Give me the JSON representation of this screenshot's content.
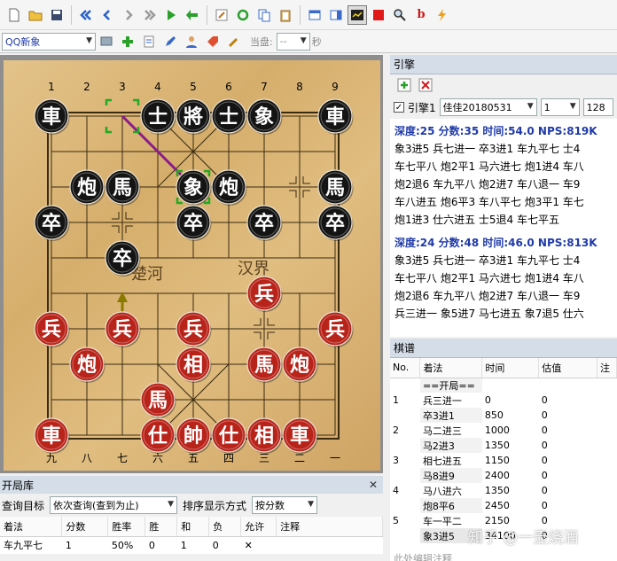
{
  "toolbar": {
    "icons": [
      "new-file-icon",
      "open-folder-icon",
      "save-icon",
      "first-move-icon",
      "prev-move-icon",
      "next-move-icon",
      "last-move-icon",
      "play-icon",
      "back-icon",
      "edit-icon",
      "refresh-icon",
      "copy-icon",
      "paste-icon",
      "window-icon",
      "layout-icon",
      "analysis-icon",
      "red-square-icon",
      "search-icon",
      "b-icon",
      "lightning-icon"
    ],
    "profile": "QQ新象",
    "step_label": "当盘:",
    "step_value": "--",
    "seconds_label": "秒"
  },
  "board": {
    "file_numbers_top": [
      "1",
      "2",
      "3",
      "4",
      "5",
      "6",
      "7",
      "8",
      "9"
    ],
    "file_numbers_bottom": [
      "九",
      "八",
      "七",
      "六",
      "五",
      "四",
      "三",
      "二",
      "一"
    ],
    "river_left": "楚河",
    "river_right": "汉界",
    "pieces": [
      {
        "side": "black",
        "char": "車",
        "file": 0,
        "rank": 0
      },
      {
        "side": "black",
        "char": "士",
        "file": 3,
        "rank": 0
      },
      {
        "side": "black",
        "char": "將",
        "file": 4,
        "rank": 0
      },
      {
        "side": "black",
        "char": "士",
        "file": 5,
        "rank": 0
      },
      {
        "side": "black",
        "char": "象",
        "file": 6,
        "rank": 0
      },
      {
        "side": "black",
        "char": "車",
        "file": 8,
        "rank": 0
      },
      {
        "side": "black",
        "char": "炮",
        "file": 1,
        "rank": 2
      },
      {
        "side": "black",
        "char": "馬",
        "file": 2,
        "rank": 2
      },
      {
        "side": "black",
        "char": "象",
        "file": 4,
        "rank": 2
      },
      {
        "side": "black",
        "char": "炮",
        "file": 5,
        "rank": 2
      },
      {
        "side": "black",
        "char": "馬",
        "file": 8,
        "rank": 2
      },
      {
        "side": "black",
        "char": "卒",
        "file": 0,
        "rank": 3
      },
      {
        "side": "black",
        "char": "卒",
        "file": 4,
        "rank": 3
      },
      {
        "side": "black",
        "char": "卒",
        "file": 6,
        "rank": 3
      },
      {
        "side": "black",
        "char": "卒",
        "file": 8,
        "rank": 3
      },
      {
        "side": "black",
        "char": "卒",
        "file": 2,
        "rank": 4
      },
      {
        "side": "red",
        "char": "兵",
        "file": 6,
        "rank": 5
      },
      {
        "side": "red",
        "char": "兵",
        "file": 0,
        "rank": 6
      },
      {
        "side": "red",
        "char": "兵",
        "file": 2,
        "rank": 6
      },
      {
        "side": "red",
        "char": "兵",
        "file": 4,
        "rank": 6
      },
      {
        "side": "red",
        "char": "兵",
        "file": 8,
        "rank": 6
      },
      {
        "side": "red",
        "char": "炮",
        "file": 1,
        "rank": 7
      },
      {
        "side": "red",
        "char": "相",
        "file": 4,
        "rank": 7
      },
      {
        "side": "red",
        "char": "馬",
        "file": 6,
        "rank": 7
      },
      {
        "side": "red",
        "char": "炮",
        "file": 7,
        "rank": 7
      },
      {
        "side": "red",
        "char": "馬",
        "file": 3,
        "rank": 8
      },
      {
        "side": "red",
        "char": "車",
        "file": 0,
        "rank": 9
      },
      {
        "side": "red",
        "char": "仕",
        "file": 3,
        "rank": 9
      },
      {
        "side": "red",
        "char": "帥",
        "file": 4,
        "rank": 9
      },
      {
        "side": "red",
        "char": "仕",
        "file": 5,
        "rank": 9
      },
      {
        "side": "red",
        "char": "相",
        "file": 6,
        "rank": 9
      },
      {
        "side": "red",
        "char": "車",
        "file": 7,
        "rank": 9
      }
    ]
  },
  "engine": {
    "title": "引擎",
    "checkbox_label": "引擎1",
    "engine_name": "佳佳20180531",
    "thread_value": "1",
    "hash_value": "128",
    "blocks": [
      {
        "header": "深度:25 分数:35 时间:54.0 NPS:819K",
        "lines": [
          "象3进5 兵七进一 卒3进1 车九平七 士4",
          "车七平八 炮2平1 马六进七 炮1进4 车八",
          "炮2退6 车九平八 炮2进7 车八退一 车9",
          "车八进五 炮6平3 车八平七 炮3平1 车七",
          "炮1进3 仕六进五 士5退4 车七平五"
        ]
      },
      {
        "header": "深度:24 分数:48 时间:46.0 NPS:813K",
        "lines": [
          "象3进5 兵七进一 卒3进1 车九平七 士4",
          "车七平八 炮2平1 马六进七 炮1进4 车八",
          "炮2退6 车九平八 炮2进7 车八退一 车9",
          "兵三进一 象5进7 马七进五 象7退5 仕六"
        ]
      }
    ]
  },
  "notation": {
    "title": "棋谱",
    "columns": [
      "No.",
      "着法",
      "时间",
      "估值",
      "注"
    ],
    "rows": [
      {
        "no": "",
        "move": "==开局==",
        "time": "",
        "eval": ""
      },
      {
        "no": "1",
        "move": "兵三进一",
        "time": "0",
        "eval": "0"
      },
      {
        "no": "",
        "move": "卒3进1",
        "time": "850",
        "eval": "0"
      },
      {
        "no": "2",
        "move": "马二进三",
        "time": "1000",
        "eval": "0"
      },
      {
        "no": "",
        "move": "马2进3",
        "time": "1350",
        "eval": "0"
      },
      {
        "no": "3",
        "move": "相七进五",
        "time": "1150",
        "eval": "0"
      },
      {
        "no": "",
        "move": "马8进9",
        "time": "2400",
        "eval": "0"
      },
      {
        "no": "4",
        "move": "马八进六",
        "time": "1350",
        "eval": "0"
      },
      {
        "no": "",
        "move": "炮8平6",
        "time": "2450",
        "eval": "0"
      },
      {
        "no": "5",
        "move": "车一平二",
        "time": "2150",
        "eval": "0"
      },
      {
        "no": "",
        "move": "象3进5",
        "time": "34100",
        "eval": "0"
      }
    ],
    "comment_label": "此处编辑注释"
  },
  "opening": {
    "title": "开局库",
    "query_label": "查询目标",
    "query_value": "依次查询(查到为止)",
    "sort_label": "排序显示方式",
    "sort_value": "按分数",
    "columns": [
      "着法",
      "分数",
      "胜率",
      "胜",
      "和",
      "负",
      "允许",
      "注释"
    ],
    "rows": [
      {
        "move": "车九平七",
        "score": "1",
        "rate": "50%",
        "win": "0",
        "draw": "1",
        "loss": "0",
        "allow": "✕",
        "note": ""
      }
    ]
  },
  "watermark": "知乎 @一壶烧酒",
  "colors": {
    "accent": "#1f3aa8",
    "red_piece": "#b8231a",
    "black_piece": "#141414",
    "arrow": "#8b1a8b"
  }
}
